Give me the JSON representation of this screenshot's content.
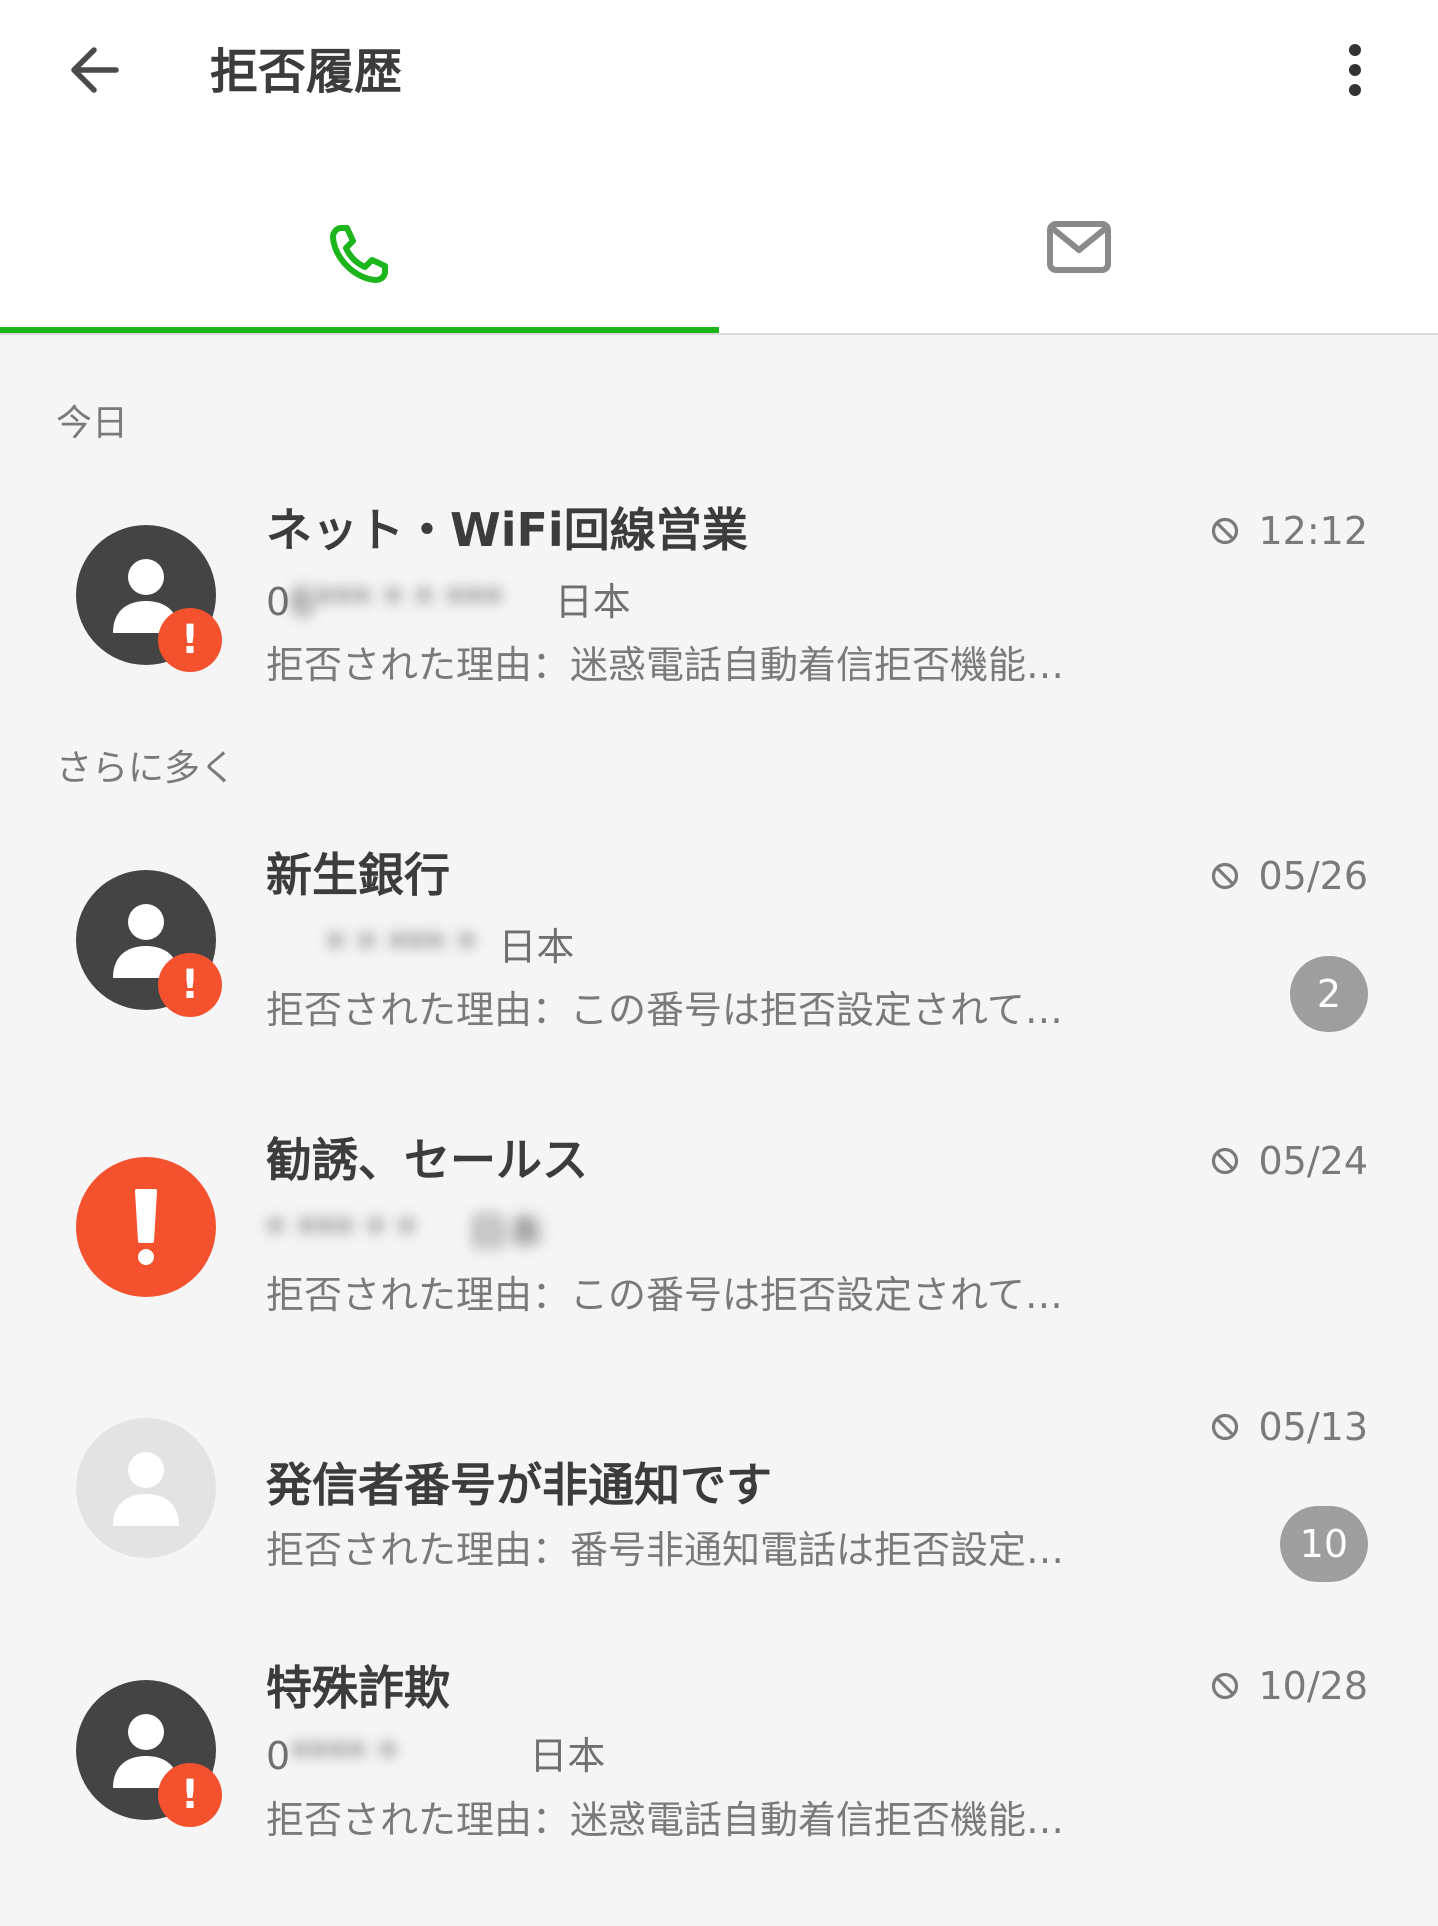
{
  "header": {
    "title": "拒否履歴",
    "back_icon": "arrow-left-icon",
    "more_icon": "more-vert-icon"
  },
  "tabs": [
    {
      "name": "calls",
      "icon": "phone-icon",
      "active": true
    },
    {
      "name": "messages",
      "icon": "mail-icon",
      "active": false
    }
  ],
  "colors": {
    "accent": "#1cb51c",
    "alert": "#f4522f",
    "badge": "#9e9e9e",
    "avatar_dark": "#444444",
    "avatar_light": "#e3e3e3"
  },
  "sections": {
    "today": "今日",
    "more": "さらに多く"
  },
  "items": [
    {
      "name": "ネット・WiFi回線営業",
      "number": "0",
      "number_blurred": "6*** * * ***",
      "region": "日本",
      "reason": "拒否された理由：迷惑電話自動着信拒否機能…",
      "time": "12:12",
      "avatar": "person-icon",
      "warning": "!"
    },
    {
      "name": "新生銀行",
      "number": "",
      "number_blurred": "* * *** *",
      "region": "日本",
      "reason": "拒否された理由：この番号は拒否設定されて…",
      "time": "05/26",
      "count": "2",
      "avatar": "person-icon",
      "warning": "!"
    },
    {
      "name": "勧誘、セールス",
      "number": "",
      "number_blurred": "* *** * *",
      "region": "日本",
      "reason": "拒否された理由：この番号は拒否設定されて…",
      "time": "05/24",
      "avatar": "exclamation-icon",
      "warning": "!"
    },
    {
      "name": "発信者番号が非通知です",
      "reason": "拒否された理由：番号非通知電話は拒否設定…",
      "time": "05/13",
      "count": "10",
      "avatar": "person-icon"
    },
    {
      "name": "特殊詐欺",
      "number": "0",
      "number_blurred": "**** *",
      "region": "日本",
      "reason": "拒否された理由：迷惑電話自動着信拒否機能…",
      "time": "10/28",
      "avatar": "person-icon",
      "warning": "!"
    }
  ]
}
